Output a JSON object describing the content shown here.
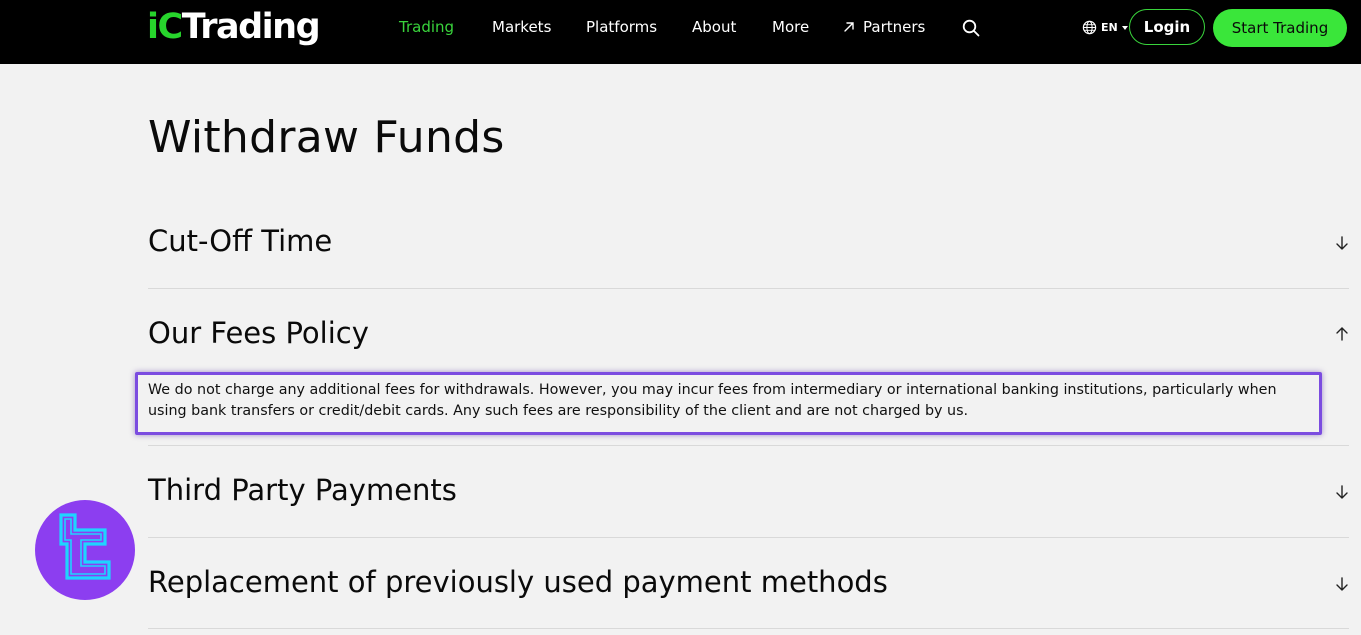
{
  "header": {
    "logo": {
      "part1": "iC",
      "part2": "Trading"
    },
    "nav": [
      {
        "label": "Trading",
        "active": true
      },
      {
        "label": "Markets",
        "active": false
      },
      {
        "label": "Platforms",
        "active": false
      },
      {
        "label": "About",
        "active": false
      },
      {
        "label": "More",
        "active": false
      },
      {
        "label": "Partners",
        "active": false
      }
    ],
    "language": "EN",
    "login_label": "Login",
    "start_trading_label": "Start Trading",
    "accent_color": "#3ae63a"
  },
  "page": {
    "title": "Withdraw Funds",
    "sections": [
      {
        "title": "Cut-Off Time",
        "expanded": false
      },
      {
        "title": "Our Fees Policy",
        "expanded": true,
        "body": "We do not charge any additional fees for withdrawals. However, you may incur fees from intermediary or international banking institutions, particularly when using bank transfers or credit/debit cards. Any such fees are responsibility of the client and are not charged by us."
      },
      {
        "title": "Third Party Payments",
        "expanded": false
      },
      {
        "title": "Replacement of previously used payment methods",
        "expanded": false
      }
    ]
  },
  "highlight_color": "#7b4ce0",
  "badge_color": "#8c3ef0",
  "icons": [
    "globe-icon",
    "search-icon",
    "arrow-up-right-icon",
    "chevron-down-icon",
    "arrow-down-icon",
    "arrow-up-icon"
  ]
}
